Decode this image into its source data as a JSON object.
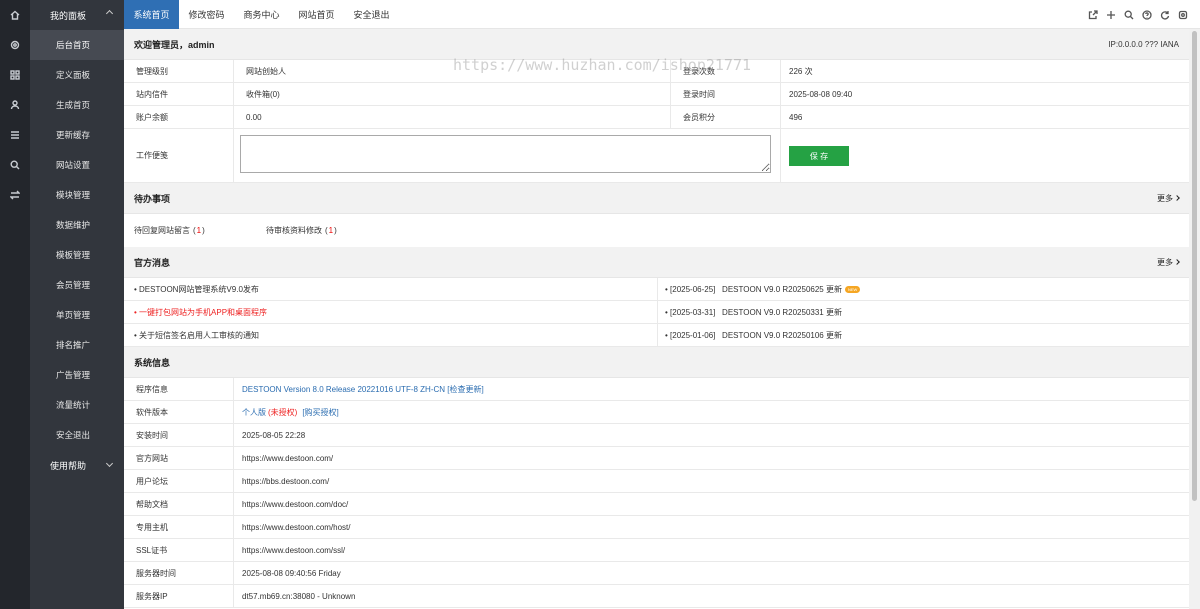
{
  "menu": {
    "header": "我的面板",
    "items": [
      "后台首页",
      "定义面板",
      "生成首页",
      "更新缓存",
      "网站设置",
      "模块管理",
      "数据维护",
      "模板管理",
      "会员管理",
      "单页管理",
      "排名推广",
      "广告管理",
      "流量统计",
      "安全退出"
    ],
    "help": "使用帮助"
  },
  "rail_icons": [
    "home-icon",
    "gear-icon",
    "grid-icon",
    "user-icon",
    "list-icon",
    "search-icon",
    "switch-icon"
  ],
  "tabs": [
    "系统首页",
    "修改密码",
    "商务中心",
    "网站首页",
    "安全退出"
  ],
  "tool_icons": [
    "share-icon",
    "plus-icon",
    "search-icon",
    "help-icon",
    "refresh-icon",
    "settings-icon"
  ],
  "welcome": {
    "title": "欢迎管理员，admin",
    "ip": "IP:0.0.0.0 ??? IANA"
  },
  "account": {
    "level_label": "管理级别",
    "level": "网站创始人",
    "login_count_label": "登录次数",
    "login_count": "226 次",
    "mail_label": "站内信件",
    "mail": "收件箱(0)",
    "login_time_label": "登录时间",
    "login_time": "2025-08-08 09:40",
    "balance_label": "账户余额",
    "balance": "0.00",
    "points_label": "会员积分",
    "points": "496",
    "memo_label": "工作便笺",
    "save": "保 存"
  },
  "todo": {
    "title": "待办事项",
    "more": "更多",
    "items": [
      {
        "label": "待回复网站留言",
        "open": "(",
        "count": "1",
        "close": ")"
      },
      {
        "label": "待审核资料修改",
        "open": "(",
        "count": "1",
        "close": ")"
      }
    ]
  },
  "news": {
    "title": "官方消息",
    "more": "更多",
    "left": [
      "• DESTOON网站管理系统V9.0发布",
      "• 一键打包网站为手机APP和桌面程序",
      "• 关于短信签名启用人工审核的通知"
    ],
    "right": [
      "• [2025-06-25]   DESTOON V9.0 R20250625 更新",
      "• [2025-03-31]   DESTOON V9.0 R20250331 更新",
      "• [2025-01-06]   DESTOON V9.0 R20250106 更新"
    ],
    "badge": "NEW"
  },
  "sysinfo": {
    "title": "系统信息",
    "rows": [
      {
        "label": "程序信息",
        "value": "DESTOON Version 8.0 Release 20221016 UTF-8 ZH-CN [检查更新]"
      },
      {
        "label": "软件版本",
        "value": "个人版",
        "value2": "(未授权)",
        "value3": "[购买授权]"
      },
      {
        "label": "安装时间",
        "value": "2025-08-05 22:28"
      },
      {
        "label": "官方网站",
        "value": "https://www.destoon.com/"
      },
      {
        "label": "用户论坛",
        "value": "https://bbs.destoon.com/"
      },
      {
        "label": "帮助文档",
        "value": "https://www.destoon.com/doc/"
      },
      {
        "label": "专用主机",
        "value": "https://www.destoon.com/host/"
      },
      {
        "label": "SSL证书",
        "value": "https://www.destoon.com/ssl/"
      },
      {
        "label": "服务器时间",
        "value": "2025-08-08 09:40:56 Friday"
      },
      {
        "label": "服务器IP",
        "value": "dt57.mb69.cn:38080 - Unknown"
      }
    ]
  },
  "watermark": "https://www.huzhan.com/ishop21771"
}
